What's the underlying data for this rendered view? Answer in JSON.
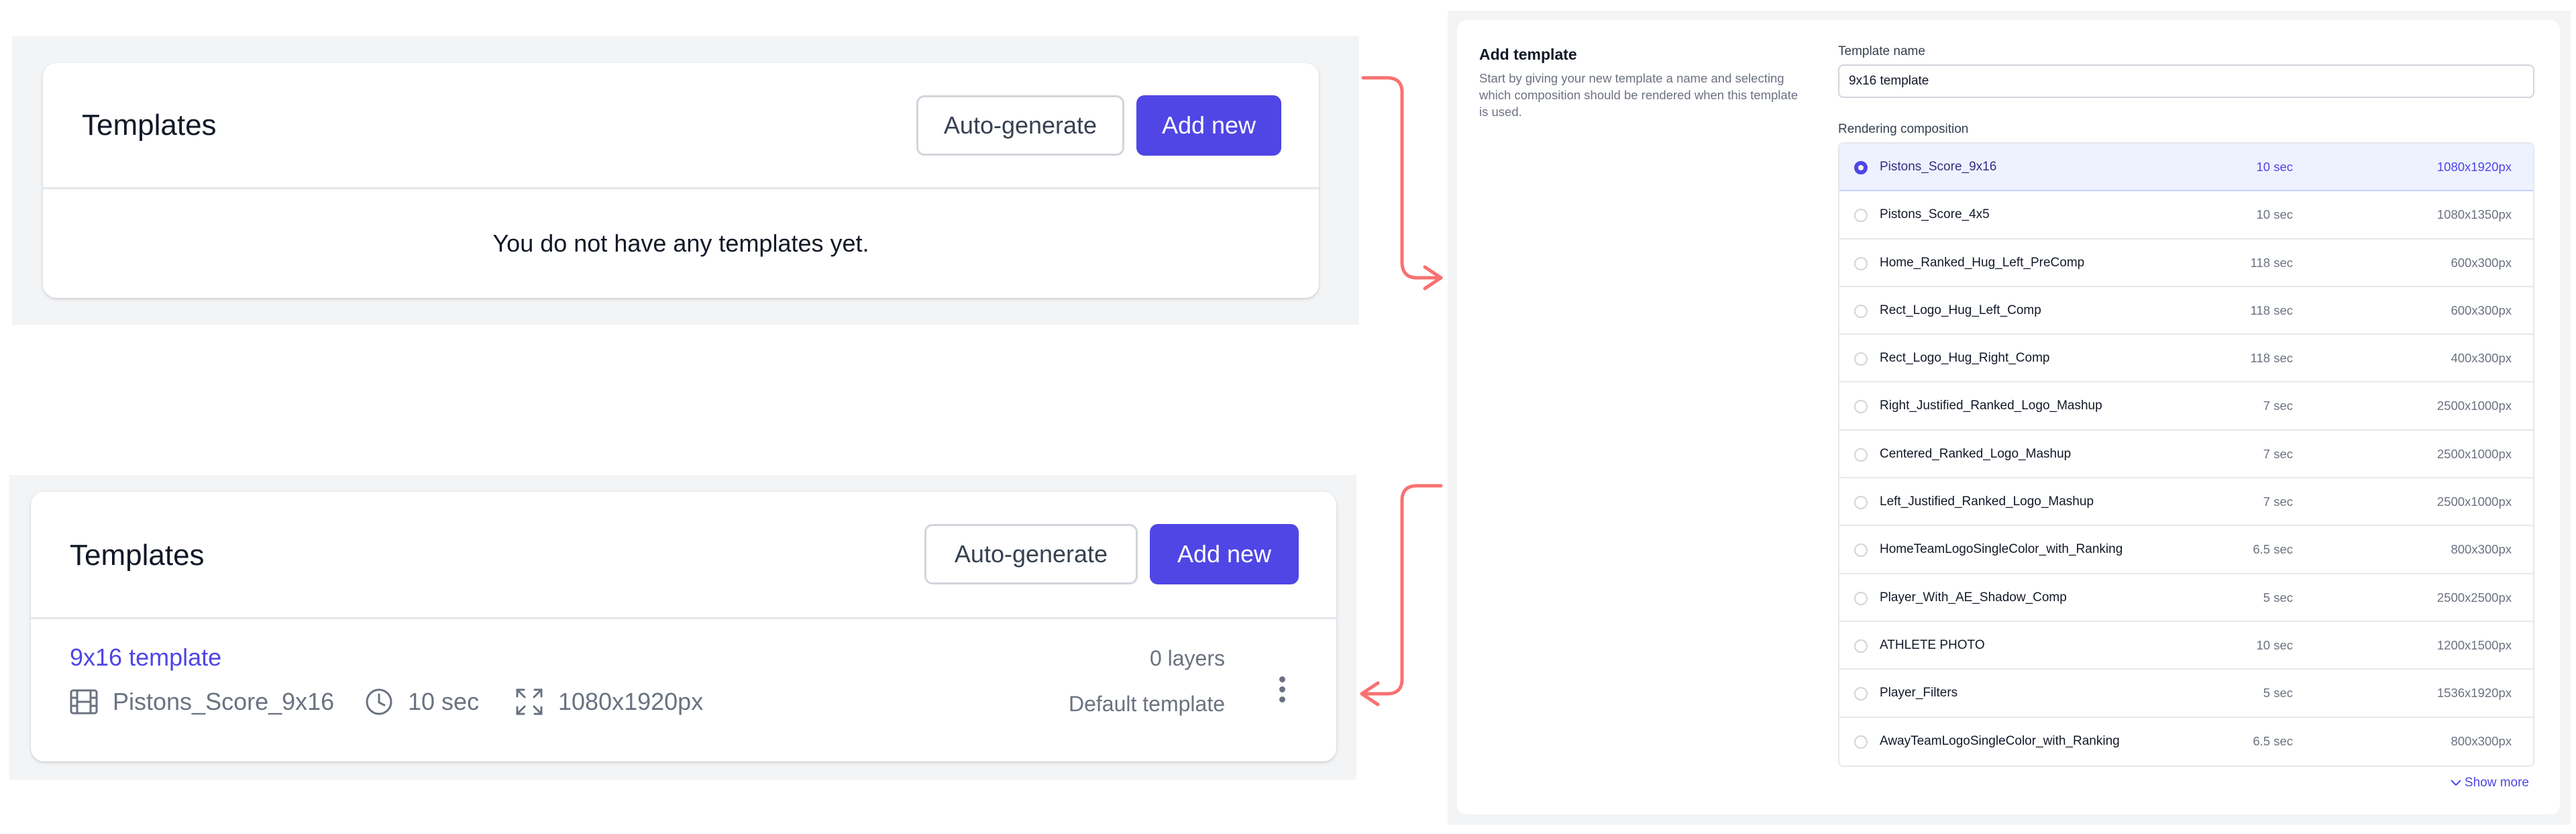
{
  "panel_empty": {
    "title": "Templates",
    "auto_generate_label": "Auto-generate",
    "add_new_label": "Add new",
    "empty_message": "You do not have any templates yet."
  },
  "panel_filled": {
    "title": "Templates",
    "auto_generate_label": "Auto-generate",
    "add_new_label": "Add new",
    "template": {
      "name": "9x16 template",
      "composition": "Pistons_Score_9x16",
      "duration": "10 sec",
      "resolution": "1080x1920px",
      "layers": "0 layers",
      "status": "Default template"
    }
  },
  "add_template": {
    "title": "Add template",
    "description": "Start by giving your new template a name and selecting which composition should be rendered when this template is used.",
    "name_label": "Template name",
    "name_value": "9x16 template",
    "composition_label": "Rendering composition",
    "compositions": [
      {
        "name": "Pistons_Score_9x16",
        "duration": "10 sec",
        "resolution": "1080x1920px",
        "selected": true
      },
      {
        "name": "Pistons_Score_4x5",
        "duration": "10 sec",
        "resolution": "1080x1350px",
        "selected": false
      },
      {
        "name": "Home_Ranked_Hug_Left_PreComp",
        "duration": "118 sec",
        "resolution": "600x300px",
        "selected": false
      },
      {
        "name": "Rect_Logo_Hug_Left_Comp",
        "duration": "118 sec",
        "resolution": "600x300px",
        "selected": false
      },
      {
        "name": "Rect_Logo_Hug_Right_Comp",
        "duration": "118 sec",
        "resolution": "400x300px",
        "selected": false
      },
      {
        "name": "Right_Justified_Ranked_Logo_Mashup",
        "duration": "7 sec",
        "resolution": "2500x1000px",
        "selected": false
      },
      {
        "name": "Centered_Ranked_Logo_Mashup",
        "duration": "7 sec",
        "resolution": "2500x1000px",
        "selected": false
      },
      {
        "name": "Left_Justified_Ranked_Logo_Mashup",
        "duration": "7 sec",
        "resolution": "2500x1000px",
        "selected": false
      },
      {
        "name": "HomeTeamLogoSingleColor_with_Ranking",
        "duration": "6.5 sec",
        "resolution": "800x300px",
        "selected": false
      },
      {
        "name": "Player_With_AE_Shadow_Comp",
        "duration": "5 sec",
        "resolution": "2500x2500px",
        "selected": false
      },
      {
        "name": "ATHLETE PHOTO",
        "duration": "10 sec",
        "resolution": "1200x1500px",
        "selected": false
      },
      {
        "name": "Player_Filters",
        "duration": "5 sec",
        "resolution": "1536x1920px",
        "selected": false
      },
      {
        "name": "AwayTeamLogoSingleColor_with_Ranking",
        "duration": "6.5 sec",
        "resolution": "800x300px",
        "selected": false
      }
    ],
    "show_more_label": "Show more"
  },
  "colors": {
    "accent": "#4f46e5",
    "arrow": "#f87171",
    "panel_bg": "#f3f4f6"
  }
}
